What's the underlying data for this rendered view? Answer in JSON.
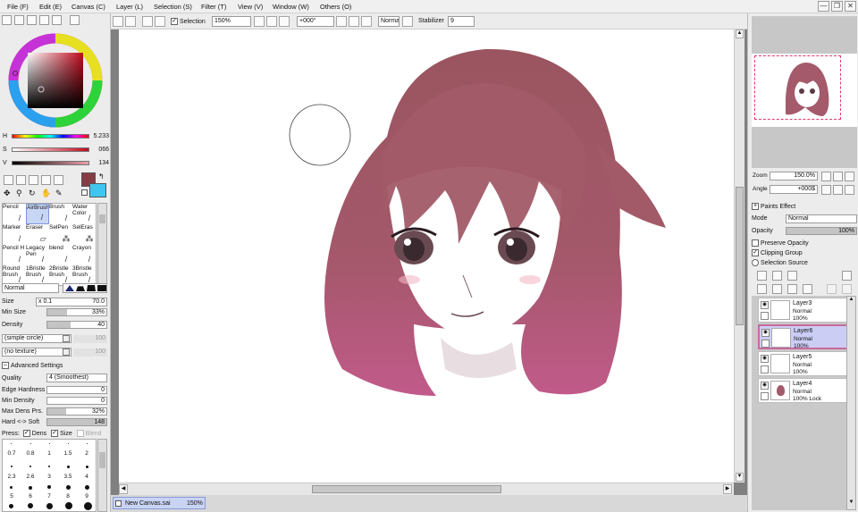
{
  "menu": [
    "File (F)",
    "Edit (E)",
    "Canvas (C)",
    "Layer (L)",
    "Selection (S)",
    "Filter (T)",
    "View (V)",
    "Window (W)",
    "Others (O)"
  ],
  "window_controls": {
    "minimize": "—",
    "restore": "❐",
    "close": "✕"
  },
  "toolbar": {
    "selection_label": "Selection",
    "zoom": "150%",
    "rotation": "+000°",
    "blend_mode": "Normal",
    "stabilizer_label": "Stabilizer",
    "stabilizer_value": "9"
  },
  "color": {
    "h_label": "H",
    "h_value": "5.233",
    "s_label": "S",
    "s_value": "066",
    "v_label": "V",
    "v_value": "134",
    "current": "#863c44",
    "secondary": "#3ec6f0",
    "hue_accent": "#c00a1d"
  },
  "tools": [
    {
      "name": "Pencil",
      "icon": "pencil-icon"
    },
    {
      "name": "AirBrush",
      "icon": "airbrush-icon",
      "selected": true
    },
    {
      "name": "Brush",
      "icon": "brush-icon"
    },
    {
      "name": "Water Color",
      "icon": "watercolor-icon"
    },
    {
      "name": "Marker",
      "icon": "marker-icon"
    },
    {
      "name": "Eraser",
      "icon": "eraser-icon"
    },
    {
      "name": "SelPen",
      "icon": "selpen-icon"
    },
    {
      "name": "SelEras",
      "icon": "seleras-icon"
    },
    {
      "name": "Pencil H",
      "icon": "pencil-icon"
    },
    {
      "name": "Legacy Pen",
      "icon": "pen-icon"
    },
    {
      "name": "blend",
      "icon": "blend-icon"
    },
    {
      "name": "Crayon",
      "icon": "crayon-icon"
    },
    {
      "name": "Round Brush",
      "icon": "brush-icon"
    },
    {
      "name": "1Bristle Brush",
      "icon": "brush-icon"
    },
    {
      "name": "2Bristle Brush",
      "icon": "brush-icon"
    },
    {
      "name": "3Bristle Brush",
      "icon": "brush-icon"
    }
  ],
  "brush": {
    "mode": "Normal",
    "size_label": "Size",
    "size_mult": "x 0.1",
    "size_value": "70.0",
    "min_size_label": "Min Size",
    "min_size_value": "33%",
    "min_size_fraction": 0.33,
    "density_label": "Density",
    "density_value": "40",
    "density_fraction": 0.4,
    "shape": "(simple circle)",
    "shape_value": "100",
    "texture": "(no texture)",
    "texture_value": "100"
  },
  "advanced": {
    "title": "Advanced Settings",
    "quality_label": "Quality",
    "quality_value": "4 (Smoothest)",
    "edge_label": "Edge Hardness",
    "edge_value": "0",
    "min_density_label": "Min Density",
    "min_density_value": "0",
    "max_dens_label": "Max Dens Prs.",
    "max_dens_value": "32%",
    "max_dens_fraction": 0.32,
    "hard_soft_label": "Hard <-> Soft",
    "hard_soft_value": "148",
    "hard_soft_fraction": 1.0,
    "press_label": "Press:",
    "press_dens": "Dens",
    "press_size": "Size",
    "press_blend": "Blend"
  },
  "brush_sizes": [
    "0.7",
    "0.8",
    "1",
    "1.5",
    "2",
    "2.3",
    "2.6",
    "3",
    "3.5",
    "4",
    "5",
    "6",
    "7",
    "8",
    "9"
  ],
  "status": {
    "file": "New Canvas.sai",
    "zoom": "150%"
  },
  "navigator": {
    "zoom_label": "Zoom",
    "zoom_value": "150.0%",
    "angle_label": "Angle",
    "angle_value": "+000$"
  },
  "layer_panel": {
    "paints_effect": "Paints Effect",
    "mode_label": "Mode",
    "mode_value": "Normal",
    "opacity_label": "Opacity",
    "opacity_value": "100%",
    "preserve_opacity": "Preserve Opacity",
    "clipping_group": "Clipping Group",
    "selection_source": "Selection Source"
  },
  "layers": [
    {
      "name": "Layer3",
      "mode": "Normal",
      "opacity": "100%",
      "selected": false
    },
    {
      "name": "Layer6",
      "mode": "Normal",
      "opacity": "100%",
      "selected": true
    },
    {
      "name": "Layer5",
      "mode": "Normal",
      "opacity": "100%",
      "selected": false
    },
    {
      "name": "Layer4",
      "mode": "Normal",
      "opacity": "100% Lock",
      "selected": false
    }
  ]
}
